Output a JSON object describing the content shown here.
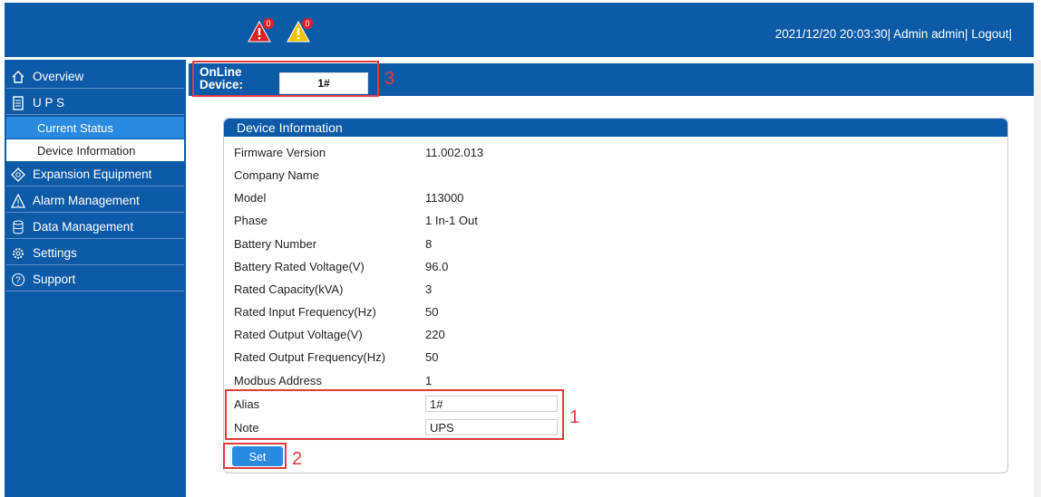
{
  "header": {
    "alarms": [
      {
        "icon": "critical-alarm-icon",
        "count": "0",
        "color": "#e02020"
      },
      {
        "icon": "warning-alarm-icon",
        "count": "0",
        "color": "#f2c200"
      }
    ],
    "datetime": "2021/12/20 20:03:30|",
    "user": "Admin admin|",
    "logout": "Logout|"
  },
  "sidebar": {
    "items": [
      {
        "label": "Overview",
        "icon": "home-icon"
      },
      {
        "label": "U P S",
        "icon": "ups-icon"
      },
      {
        "label": "Expansion Equipment",
        "icon": "expansion-icon"
      },
      {
        "label": "Alarm Management",
        "icon": "alarm-triangle-icon"
      },
      {
        "label": "Data Management",
        "icon": "database-icon"
      },
      {
        "label": "Settings",
        "icon": "gear-icon"
      },
      {
        "label": "Support",
        "icon": "help-icon"
      }
    ],
    "sub_items": [
      {
        "label": "Current Status",
        "active": true
      },
      {
        "label": "Device Information",
        "active": false
      }
    ]
  },
  "device_bar": {
    "label_line1": "OnLine",
    "label_line2": "Device:",
    "selected": "1#"
  },
  "panel": {
    "title": "Device Information",
    "fields": [
      {
        "label": "Firmware Version",
        "value": "11.002.013"
      },
      {
        "label": "Company Name",
        "value": ""
      },
      {
        "label": "Model",
        "value": "113000"
      },
      {
        "label": "Phase",
        "value": "1 In-1 Out"
      },
      {
        "label": "Battery Number",
        "value": "8"
      },
      {
        "label": "Battery Rated Voltage(V)",
        "value": "96.0"
      },
      {
        "label": "Rated Capacity(kVA)",
        "value": "3"
      },
      {
        "label": "Rated Input Frequency(Hz)",
        "value": "50"
      },
      {
        "label": "Rated Output Voltage(V)",
        "value": "220"
      },
      {
        "label": "Rated Output Frequency(Hz)",
        "value": "50"
      },
      {
        "label": "Modbus Address",
        "value": "1"
      }
    ],
    "editable": [
      {
        "label": "Alias",
        "value": "1#"
      },
      {
        "label": "Note",
        "value": "UPS"
      }
    ],
    "set_label": "Set"
  },
  "annotations": {
    "n1": "1",
    "n2": "2",
    "n3": "3",
    "color": "#e23b3b"
  },
  "colors": {
    "primary": "#0d5aa7",
    "active": "#2a8ae0"
  }
}
